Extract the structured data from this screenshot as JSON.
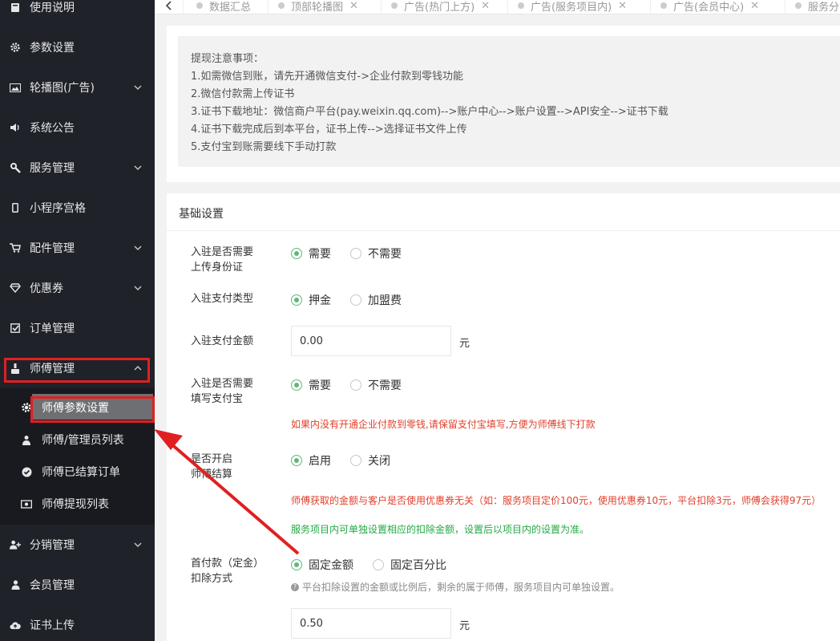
{
  "sidebar": {
    "items": [
      {
        "label": "使用说明",
        "icon": "book-icon"
      },
      {
        "label": "参数设置",
        "icon": "gear-icon"
      },
      {
        "label": "轮播图(广告)",
        "icon": "image-icon"
      },
      {
        "label": "系统公告",
        "icon": "speaker-icon"
      },
      {
        "label": "服务管理",
        "icon": "wrench-icon"
      },
      {
        "label": "小程序宫格",
        "icon": "mobile-icon"
      },
      {
        "label": "配件管理",
        "icon": "cart-icon"
      },
      {
        "label": "优惠券",
        "icon": "diamond-icon"
      },
      {
        "label": "订单管理",
        "icon": "checkbox-icon"
      },
      {
        "label": "师傅管理",
        "icon": "worker-icon"
      },
      {
        "label": "分销管理",
        "icon": "user-plus-icon"
      },
      {
        "label": "会员管理",
        "icon": "user-icon"
      },
      {
        "label": "证书上传",
        "icon": "cloud-upload-icon"
      }
    ],
    "sub_items": [
      {
        "label": "师傅参数设置",
        "icon": "gear-icon"
      },
      {
        "label": "师傅/管理员列表",
        "icon": "worker-icon"
      },
      {
        "label": "师傅已结算订单",
        "icon": "check-circle-icon"
      },
      {
        "label": "师傅提现列表",
        "icon": "money-icon"
      }
    ]
  },
  "tabs": [
    {
      "label": "数据汇总"
    },
    {
      "label": "顶部轮播图"
    },
    {
      "label": "广告(热门上方)"
    },
    {
      "label": "广告(服务项目内)"
    },
    {
      "label": "广告(会员中心)"
    },
    {
      "label": "服务分"
    }
  ],
  "notice": {
    "lines": [
      "提现注意事项：",
      "1.如需微信到账，请先开通微信支付->企业付款到零钱功能",
      "2.微信付款需上传证书",
      "3.证书下载地址：微信商户平台(pay.weixin.qq.com)-->账户中心-->账户设置-->API安全-->证书下载",
      "4.证书下载完成后到本平台，证书上传-->选择证书文件上传",
      "5.支付宝到账需要线下手动打款"
    ]
  },
  "form": {
    "section_title": "基础设置",
    "id_card": {
      "label_line1": "入驻是否需要",
      "label_line2": "上传身份证",
      "opt1": "需要",
      "opt2": "不需要"
    },
    "pay_type": {
      "label": "入驻支付类型",
      "opt1": "押金",
      "opt2": "加盟费"
    },
    "pay_amount": {
      "label": "入驻支付金额",
      "value": "0.00",
      "unit": "元"
    },
    "alipay": {
      "label_line1": "入驻是否需要",
      "label_line2": "填写支付宝",
      "opt1": "需要",
      "opt2": "不需要",
      "hint": "如果内没有开通企业付款到零钱,请保留支付宝填写,方便为师傅线下打款"
    },
    "settle": {
      "label_line1": "是否开启",
      "label_line2": "师傅结算",
      "opt1": "启用",
      "opt2": "关闭",
      "hint_red": "师傅获取的金额与客户是否使用优惠券无关（如：服务项目定价100元，使用优惠券10元，平台扣除3元，师傅会获得97元）",
      "hint_green": "服务项目内可单独设置相应的扣除金额，设置后以项目内的设置为准。"
    },
    "deposit": {
      "label_line1": "首付款（定金）",
      "label_line2": "扣除方式",
      "opt1": "固定金额",
      "opt2": "固定百分比",
      "hint": "平台扣除设置的金额或比例后，剩余的属于师傅，服务项目内可单独设置。",
      "value": "0.50",
      "unit": "元"
    }
  },
  "colors": {
    "sidebar_bg": "#20222a",
    "accent_green": "#5fb878",
    "annotation_red": "#e02020"
  }
}
